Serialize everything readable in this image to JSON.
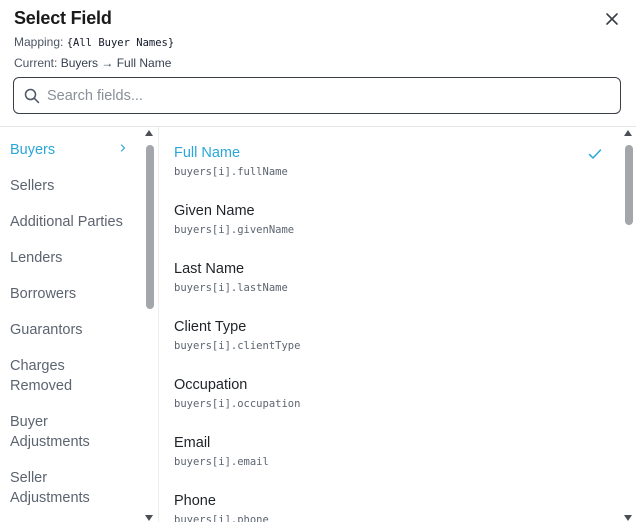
{
  "dialog": {
    "title": "Select Field",
    "mapping_label": "Mapping:",
    "mapping_value": "{All Buyer Names}",
    "current_label": "Current:",
    "current_value": "Buyers → Full Name",
    "close_icon": "close-icon"
  },
  "search": {
    "placeholder": "Search fields...",
    "value": "",
    "icon": "search-icon"
  },
  "categories": [
    {
      "label": "Buyers",
      "active": true
    },
    {
      "label": "Sellers"
    },
    {
      "label": "Additional Parties"
    },
    {
      "label": "Lenders"
    },
    {
      "label": "Borrowers"
    },
    {
      "label": "Guarantors"
    },
    {
      "label": "Charges Removed"
    },
    {
      "label": "Buyer Adjustments"
    },
    {
      "label": "Seller Adjustments"
    }
  ],
  "fields": [
    {
      "label": "Full Name",
      "path": "buyers[i].fullName",
      "selected": true
    },
    {
      "label": "Given Name",
      "path": "buyers[i].givenName"
    },
    {
      "label": "Last Name",
      "path": "buyers[i].lastName"
    },
    {
      "label": "Client Type",
      "path": "buyers[i].clientType"
    },
    {
      "label": "Occupation",
      "path": "buyers[i].occupation"
    },
    {
      "label": "Email",
      "path": "buyers[i].email"
    },
    {
      "label": "Phone",
      "path": "buyers[i].phone"
    }
  ],
  "colors": {
    "accent": "#2aa6d8",
    "text": "#1f2328",
    "muted": "#5c6470"
  }
}
